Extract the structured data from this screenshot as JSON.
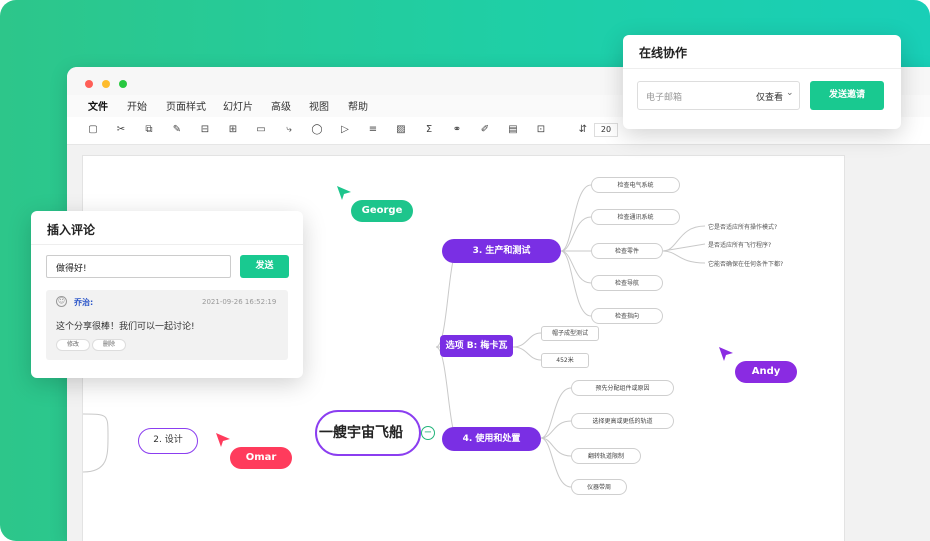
{
  "menu": {
    "items": [
      "文件",
      "开始",
      "页面样式",
      "幻灯片",
      "高级",
      "视图",
      "帮助"
    ]
  },
  "toolbar": {
    "zoom_value": "20"
  },
  "mindmap": {
    "center": "一艘宇宙飞船",
    "branch_left": "2. 设计",
    "branch_3": "3. 生产和测试",
    "branch_b": "选项 B: 梅卡瓦",
    "branch_4": "4. 使用和处置",
    "leaves_3": [
      "检查电气系统",
      "检查通讯系统",
      "检查零件",
      "检查导航",
      "检查指向"
    ],
    "questions": [
      "它是否适应所有操作模式?",
      "是否适应所有飞行程序?",
      "它能否确保在任何条件下都?"
    ],
    "leaves_b": [
      "帽子成型测试",
      "452米"
    ],
    "leaves_4": [
      "预先分配组件或原因",
      "选择更高或更低的轨道",
      "翻转轨道限制",
      "仪器带周"
    ]
  },
  "cursors": [
    {
      "name": "George",
      "color": "#1dc58c"
    },
    {
      "name": "Andy",
      "color": "#8a2be2"
    },
    {
      "name": "Omar",
      "color": "#ff3b5c"
    }
  ],
  "collab": {
    "title": "在线协作",
    "email_placeholder": "电子邮箱",
    "permission": "仅查看",
    "send_invite": "发送邀请"
  },
  "comment": {
    "title": "插入评论",
    "input_value": "做得好!",
    "send": "发送",
    "author": "乔治:",
    "timestamp": "2021-09-26 16:52:19",
    "text": "这个分享很棒！我们可以一起讨论!",
    "edit": "修改",
    "delete": "删除"
  }
}
